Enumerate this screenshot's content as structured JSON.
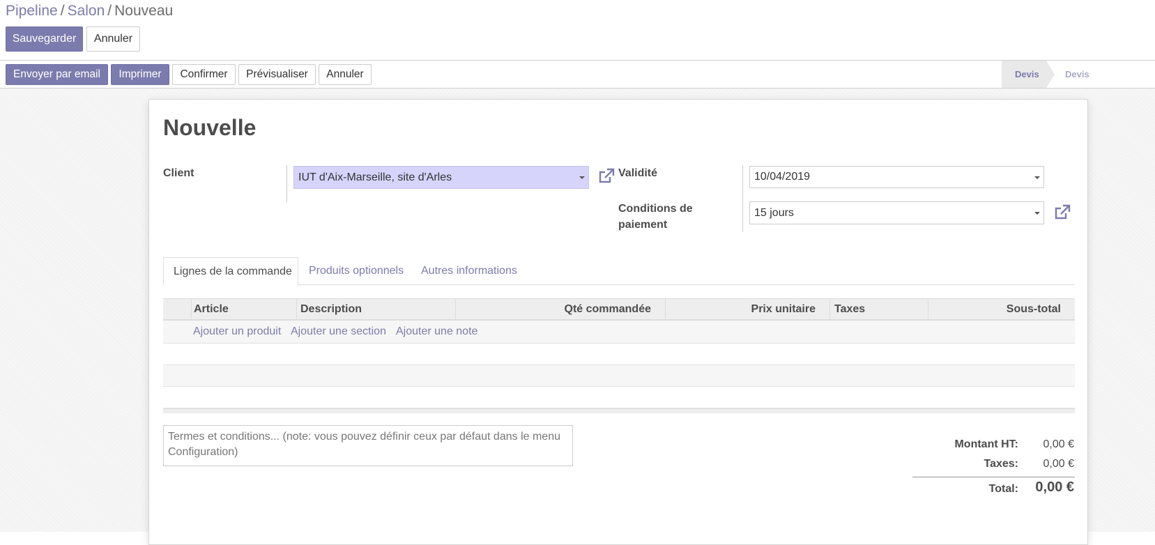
{
  "breadcrumb": {
    "item1": "Pipeline",
    "item2": "Salon",
    "current": "Nouveau",
    "separator": "/"
  },
  "control": {
    "save": "Sauvegarder",
    "discard": "Annuler"
  },
  "actions": {
    "send_email": "Envoyer par email",
    "print": "Imprimer",
    "confirm": "Confirmer",
    "preview": "Prévisualiser",
    "cancel": "Annuler"
  },
  "stages": [
    {
      "label": "Devis",
      "active": true
    },
    {
      "label": "Devis",
      "active": false
    }
  ],
  "form": {
    "title": "Nouvelle",
    "client_label": "Client",
    "client_value": "IUT d'Aix-Marseille, site d'Arles",
    "validity_label": "Validité",
    "validity_value": "10/04/2019",
    "payment_label_1": "Conditions de",
    "payment_label_2": "paiement",
    "payment_value": "15 jours"
  },
  "tabs": [
    "Lignes de la commande",
    "Produits optionnels",
    "Autres informations"
  ],
  "table": {
    "columns": [
      "Article",
      "Description",
      "Qté commandée",
      "Prix unitaire",
      "Taxes",
      "Sous-total"
    ],
    "add_product": "Ajouter un produit",
    "add_section": "Ajouter une section",
    "add_note": "Ajouter une note"
  },
  "notes_placeholder": "Termes et conditions... (note: vous pouvez définir ceux par défaut dans le menu Configuration)",
  "totals": {
    "untaxed_label": "Montant HT:",
    "untaxed_value": "0,00 €",
    "taxes_label": "Taxes:",
    "taxes_value": "0,00 €",
    "total_label": "Total:",
    "total_value": "0,00 €"
  },
  "colors": {
    "primary": "#7c7bad",
    "selected_field": "#d6d4fb",
    "sheet_bg": "#ffffff",
    "page_bg": "#f6f6f6"
  },
  "icons": {
    "external_link": "external-link-icon",
    "dropdown": "caret-down-icon"
  }
}
